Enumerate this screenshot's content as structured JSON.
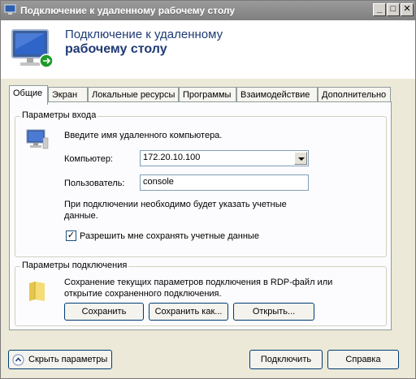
{
  "window": {
    "title": "Подключение к удаленному рабочему столу",
    "controls": {
      "minimize": "_",
      "maximize": "□",
      "close": "✕"
    }
  },
  "header": {
    "line1": "Подключение к удаленному",
    "line2": "рабочему столу"
  },
  "tabs": [
    {
      "label": "Общие",
      "active": true
    },
    {
      "label": "Экран",
      "active": false
    },
    {
      "label": "Локальные ресурсы",
      "active": false
    },
    {
      "label": "Программы",
      "active": false
    },
    {
      "label": "Взаимодействие",
      "active": false
    },
    {
      "label": "Дополнительно",
      "active": false
    }
  ],
  "login_group": {
    "title": "Параметры входа",
    "instruction": "Введите имя удаленного компьютера.",
    "computer_label": "Компьютер:",
    "computer_value": "172.20.10.100",
    "user_label": "Пользователь:",
    "user_value": "console",
    "credentials_note_line1": "При подключении необходимо будет указать учетные",
    "credentials_note_line2": "данные.",
    "save_credentials_label": "Разрешить мне сохранять учетные данные",
    "save_credentials_checked": true
  },
  "connection_group": {
    "title": "Параметры подключения",
    "description_line1": "Сохранение текущих параметров подключения в RDP-файл или",
    "description_line2": "открытие сохраненного подключения.",
    "save_button": "Сохранить",
    "save_as_button": "Сохранить как...",
    "open_button": "Открыть..."
  },
  "footer": {
    "hide_options": "Скрыть параметры",
    "connect": "Подключить",
    "help": "Справка"
  },
  "colors": {
    "title_bar": "#8a8a8a",
    "header_text": "#1f3a75",
    "button_border": "#003c74"
  }
}
